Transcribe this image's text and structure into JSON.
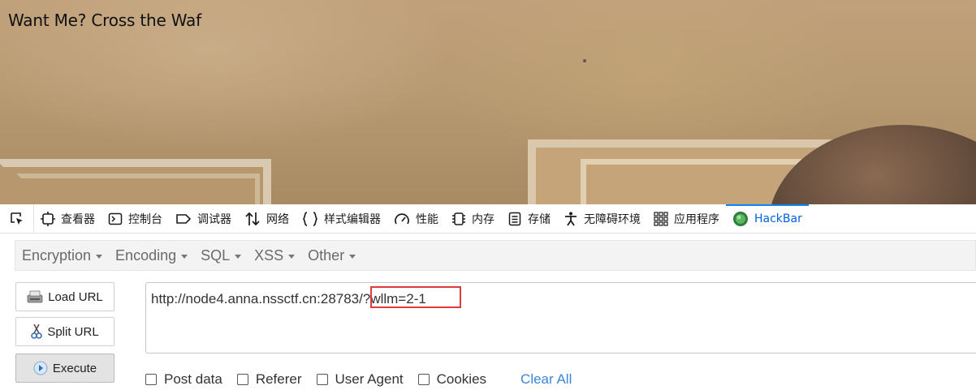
{
  "page": {
    "title": "Want Me? Cross the Waf"
  },
  "devtools": {
    "tabs": [
      {
        "label": "查看器",
        "icon": "inspector-icon"
      },
      {
        "label": "控制台",
        "icon": "console-icon"
      },
      {
        "label": "调试器",
        "icon": "debugger-icon"
      },
      {
        "label": "网络",
        "icon": "network-icon"
      },
      {
        "label": "样式编辑器",
        "icon": "style-editor-icon"
      },
      {
        "label": "性能",
        "icon": "performance-icon"
      },
      {
        "label": "内存",
        "icon": "memory-icon"
      },
      {
        "label": "存储",
        "icon": "storage-icon"
      },
      {
        "label": "无障碍环境",
        "icon": "accessibility-icon"
      },
      {
        "label": "应用程序",
        "icon": "application-icon"
      },
      {
        "label": "HackBar",
        "icon": "hackbar-icon",
        "active": true
      }
    ],
    "active_color": "#0060df"
  },
  "hackbar": {
    "menu": [
      {
        "label": "Encryption"
      },
      {
        "label": "Encoding"
      },
      {
        "label": "SQL"
      },
      {
        "label": "XSS"
      },
      {
        "label": "Other"
      }
    ],
    "buttons": {
      "load_url": "Load URL",
      "split_url": "Split URL",
      "execute": "Execute"
    },
    "url": "http://node4.anna.nssctf.cn:28783/?wllm=2-1",
    "highlight_color": "#e03b3b",
    "options": {
      "post_data": "Post data",
      "referer": "Referer",
      "user_agent": "User Agent",
      "cookies": "Cookies"
    },
    "clear_all": "Clear All"
  }
}
